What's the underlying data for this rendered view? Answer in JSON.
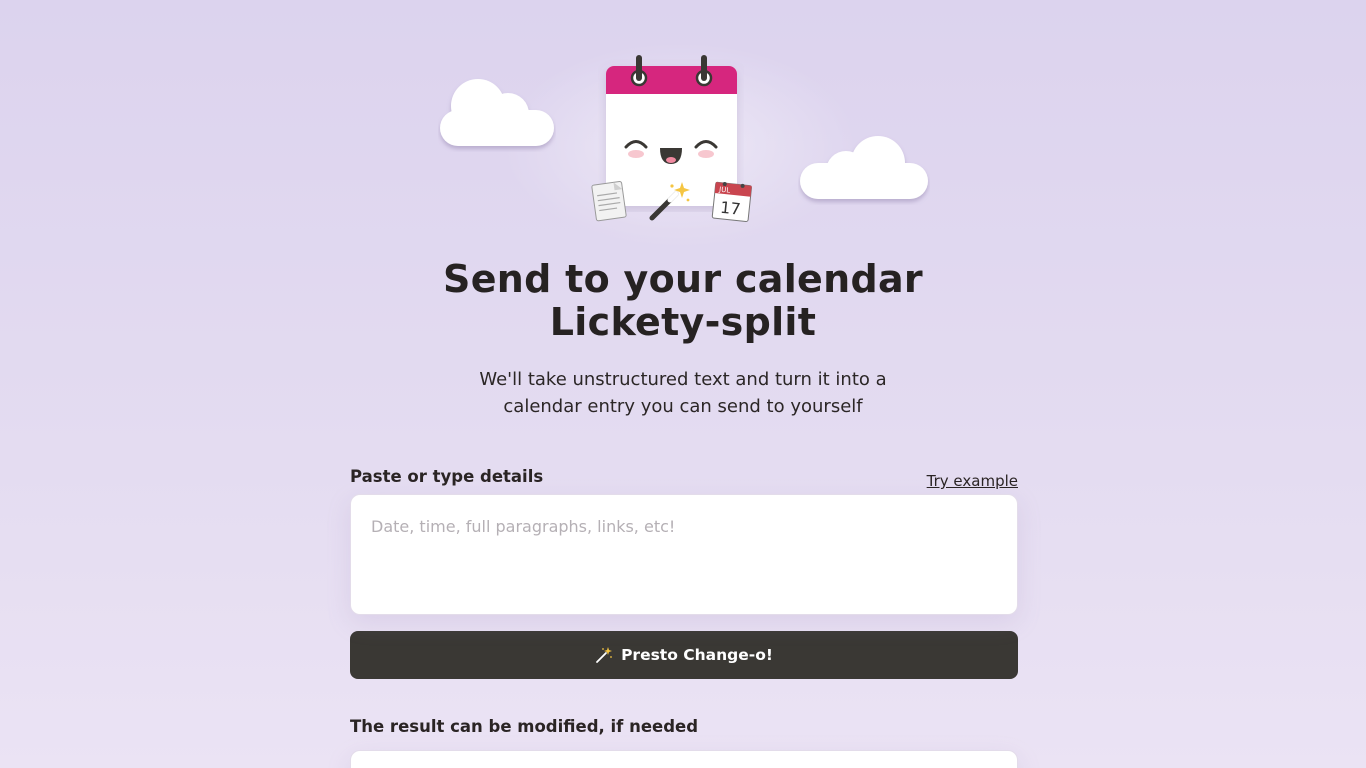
{
  "hero": {
    "icons": [
      "cloud-icon",
      "calendar-mascot-icon",
      "document-icon",
      "magic-wand-icon",
      "date-calendar-icon"
    ],
    "date_icon_month": "JUL",
    "date_icon_day": "17"
  },
  "headline": {
    "line1": "Send to your calendar",
    "line2": "Lickety-split"
  },
  "subtitle": {
    "line1": "We'll take unstructured text and turn it into a",
    "line2": "calendar entry you can send to yourself"
  },
  "form": {
    "details_label": "Paste or type details",
    "try_example_label": "Try example",
    "details_placeholder": "Date, time, full paragraphs, links, etc!",
    "details_value": "",
    "submit_label": "Presto Change-o!",
    "submit_icon": "sparkle-wand-icon"
  },
  "result": {
    "label": "The result can be modified, if needed"
  },
  "colors": {
    "background": "#dcd3ee",
    "calendar_header": "#d6267e",
    "button": "#3a3834",
    "text": "#222222"
  }
}
